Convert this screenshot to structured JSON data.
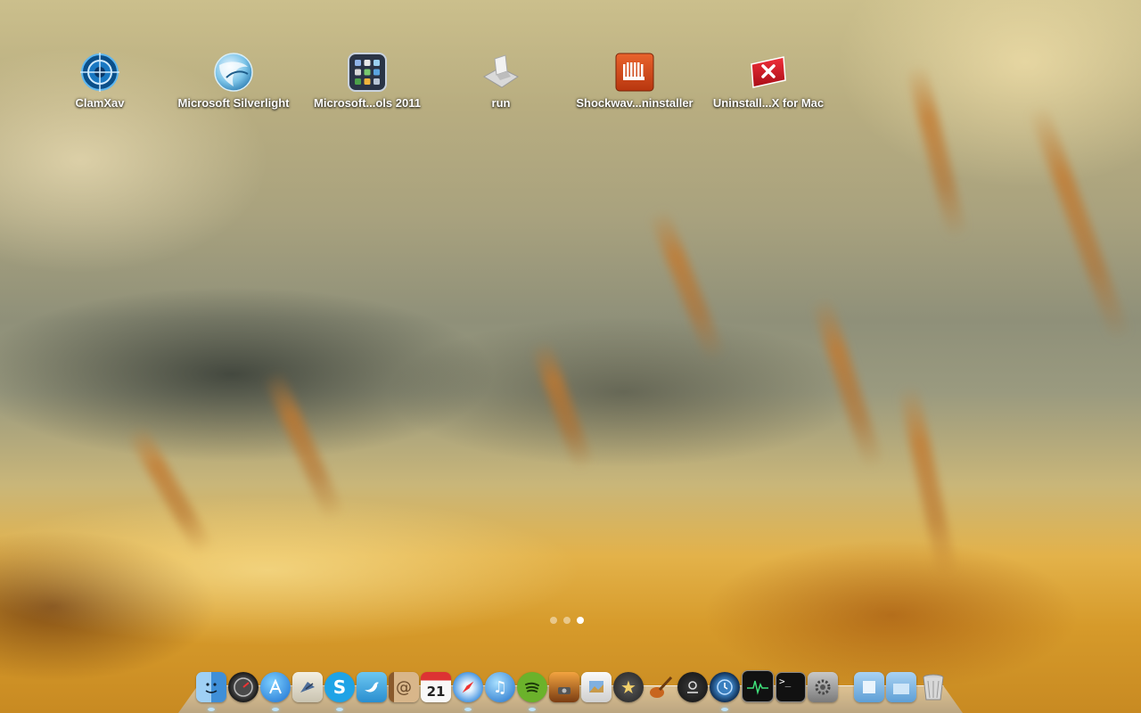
{
  "apps": [
    {
      "label": "ClamXav",
      "icon": "clamxav-icon"
    },
    {
      "label": "Microsoft Silverlight",
      "icon": "silverlight-icon"
    },
    {
      "label": "Microsoft...ols 2011",
      "icon": "office-tools-folder-icon"
    },
    {
      "label": "run",
      "icon": "run-icon"
    },
    {
      "label": "Shockwav...ninstaller",
      "icon": "shockwave-icon"
    },
    {
      "label": "Uninstall...X for Mac",
      "icon": "uninstall-flash-icon"
    }
  ],
  "pagination": {
    "pages": 3,
    "current": 3
  },
  "dock": {
    "calendar_day": "21",
    "items": [
      "finder-icon",
      "dashboard-icon",
      "app-store-icon",
      "mail-icon",
      "skype-icon",
      "twitter-icon",
      "address-book-icon",
      "calendar-icon",
      "safari-icon",
      "itunes-icon",
      "spotify-icon",
      "iphoto-icon",
      "preview-icon",
      "imovie-icon",
      "garageband-icon",
      "camera-icon",
      "time-machine-icon",
      "activity-monitor-icon",
      "terminal-icon",
      "system-preferences-icon",
      "documents-stack-icon",
      "applications-stack-icon",
      "trash-icon"
    ]
  }
}
